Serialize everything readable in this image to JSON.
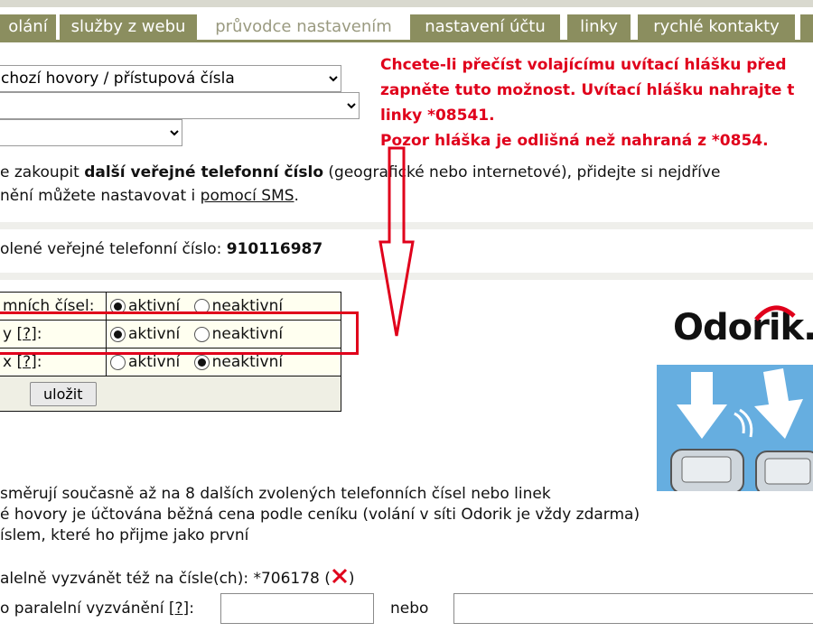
{
  "tabs": [
    {
      "label": "olání"
    },
    {
      "label": "služby z webu"
    },
    {
      "label": "průvodce nastavením"
    },
    {
      "label": "nastavení účtu"
    },
    {
      "label": "linky"
    },
    {
      "label": "rychlé kontakty"
    }
  ],
  "selects": {
    "first_value": "chozí hovory / přístupová čísla",
    "second_value": "",
    "third_value": ""
  },
  "notice": {
    "line1": "Chcete-li přečíst volajícímu uvítací hlášku před",
    "line2": "zapněte tuto možnost. Uvítací hlášku nahrajte t",
    "line3": "linky *08541.",
    "line4": "Pozor hláška je odlišná než nahraná z *0854."
  },
  "info": {
    "pre": "e zakoupit ",
    "bold": "další veřejné telefonní číslo",
    "post": " (geografické nebo internetové), přidejte si nejdříve",
    "line2_pre": "nění můžete nastavovat i ",
    "sms_link": "pomocí SMS",
    "line2_post": "."
  },
  "phone": {
    "label": "olené veřejné telefonní číslo: ",
    "number": "910116987"
  },
  "options_table": {
    "rows": [
      {
        "label": "mních čísel:",
        "help": "",
        "active": "aktivní",
        "inactive": "neaktivní",
        "selected": "active"
      },
      {
        "label": "y ",
        "help": "[?]",
        "suffix": ":",
        "active": "aktivní",
        "inactive": "neaktivní",
        "selected": "active"
      },
      {
        "label": "x ",
        "help": "[?]",
        "suffix": ":",
        "active": "aktivní",
        "inactive": "neaktivní",
        "selected": "inactive"
      }
    ],
    "save_label": "uložit"
  },
  "banner": {
    "brand": "Odorik.c"
  },
  "description": {
    "line1": "směrují současně až na 8 dalších zvolených telefonních čísel nebo linek",
    "line2": "é hovory je účtována běžná cena podle ceníku (volání v síti Odorik je vždy zdarma)",
    "line3": "íslem, které ho přijme jako první"
  },
  "parallel": {
    "label": "alelně vyzvánět též na čísle(ch): *706178 (",
    "label_end": ")",
    "add_label": "o paralelní vyzvánění ",
    "help": "[?]",
    "add_suffix": ":",
    "or_label": "nebo",
    "input1_value": "",
    "input2_value": ""
  },
  "colors": {
    "tab_bg": "#8b8e5f",
    "notice_red": "#e0001b",
    "highlight_red": "#e0001b",
    "banner_bg": "#66aee0"
  }
}
